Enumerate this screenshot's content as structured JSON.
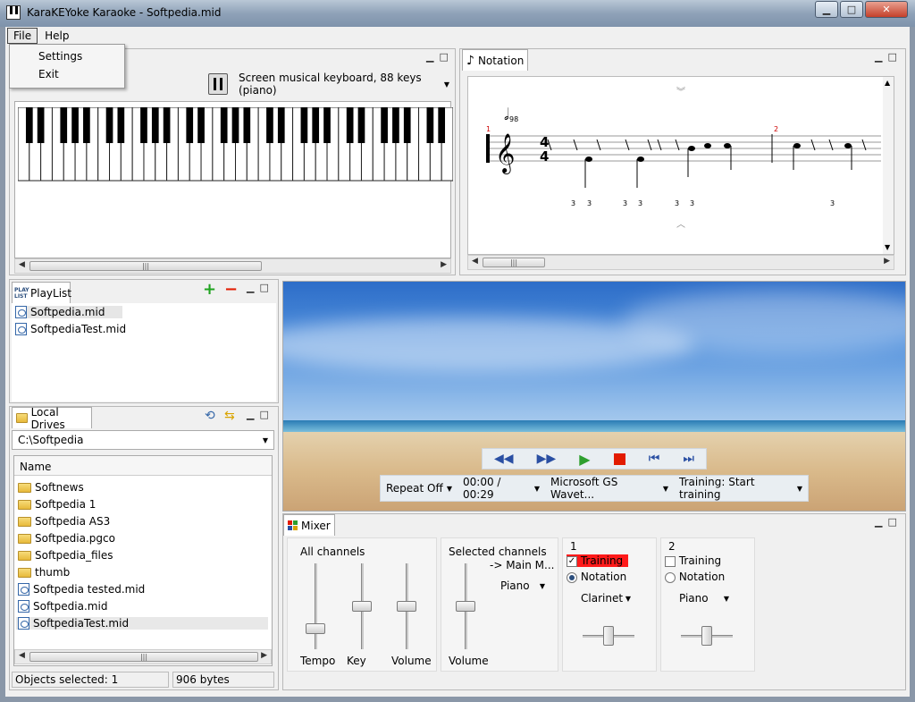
{
  "window": {
    "title": "KaraKEYoke Karaoke - Softpedia.mid"
  },
  "menu": {
    "file": "File",
    "help": "Help",
    "file_items": [
      "Settings",
      "Exit"
    ]
  },
  "keyboard_panel": {
    "selector": "Screen musical keyboard, 88 keys (piano)"
  },
  "notation_panel": {
    "tab": "Notation",
    "tempo": "98",
    "time_sig_top": "4",
    "time_sig_bottom": "4",
    "measure1": "1",
    "measure2": "2",
    "triplet_marks": [
      "3",
      "3",
      "3",
      "3",
      "3",
      "3",
      "3"
    ]
  },
  "playlist": {
    "tab": "PlayList",
    "icon_text": "PLAY LIST",
    "items": [
      "Softpedia.mid",
      "SoftpediaTest.mid"
    ]
  },
  "local_drives": {
    "tab": "Local Drives",
    "path": "C:\\Softpedia",
    "column": "Name",
    "items": [
      {
        "name": "Softnews",
        "type": "folder"
      },
      {
        "name": "Softpedia 1",
        "type": "folder"
      },
      {
        "name": "Softpedia AS3",
        "type": "folder"
      },
      {
        "name": "Softpedia.pgco",
        "type": "folder"
      },
      {
        "name": "Softpedia_files",
        "type": "folder"
      },
      {
        "name": "thumb",
        "type": "folder"
      },
      {
        "name": "Softpedia tested.mid",
        "type": "file"
      },
      {
        "name": "Softpedia.mid",
        "type": "file"
      },
      {
        "name": "SoftpediaTest.mid",
        "type": "file"
      }
    ]
  },
  "status": {
    "selected": "Objects selected: 1",
    "size": "906 bytes"
  },
  "player": {
    "repeat": "Repeat Off",
    "time": "00:00 / 00:29",
    "device": "Microsoft GS Wavet...",
    "training": "Training: Start training"
  },
  "mixer": {
    "tab": "Mixer",
    "all_channels": {
      "title": "All channels",
      "sliders": [
        {
          "label": "Tempo",
          "level": 0.2
        },
        {
          "label": "Key",
          "level": 0.5
        },
        {
          "label": "Volume",
          "level": 0.5
        }
      ]
    },
    "selected_channels": {
      "title": "Selected channels",
      "target": "-> Main M...",
      "instrument": "Piano",
      "volume_label": "Volume",
      "level": 0.5
    },
    "channels": [
      {
        "number": "1",
        "training": "Training",
        "training_checked": true,
        "notation": "Notation",
        "notation_selected": true,
        "instrument": "Clarinet",
        "level": 0.5
      },
      {
        "number": "2",
        "training": "Training",
        "training_checked": false,
        "notation": "Notation",
        "notation_selected": false,
        "instrument": "Piano",
        "level": 0.5
      }
    ]
  },
  "colors": {
    "accent_red": "#ff1a1a",
    "play_green": "#2e9f2e",
    "stop_red": "#e21b00",
    "transport_blue": "#2a4fa3",
    "title_bar": "#8fa2b8",
    "close_button": "#c4402a"
  }
}
